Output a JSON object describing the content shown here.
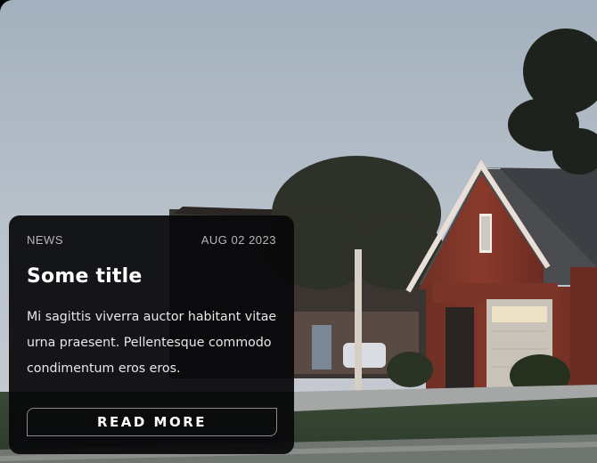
{
  "card": {
    "category": "NEWS",
    "date": "AUG 02 2023",
    "title": "Some title",
    "body": "Mi sagittis viverra auctor habitant vitae urna praesent. Pellentesque commodo condimentum eros eros.",
    "button_label": "READ MORE"
  },
  "colors": {
    "card_bg": "#08080a",
    "meta_text": "#b7b7ba",
    "button_border": "#8a8a8d"
  }
}
